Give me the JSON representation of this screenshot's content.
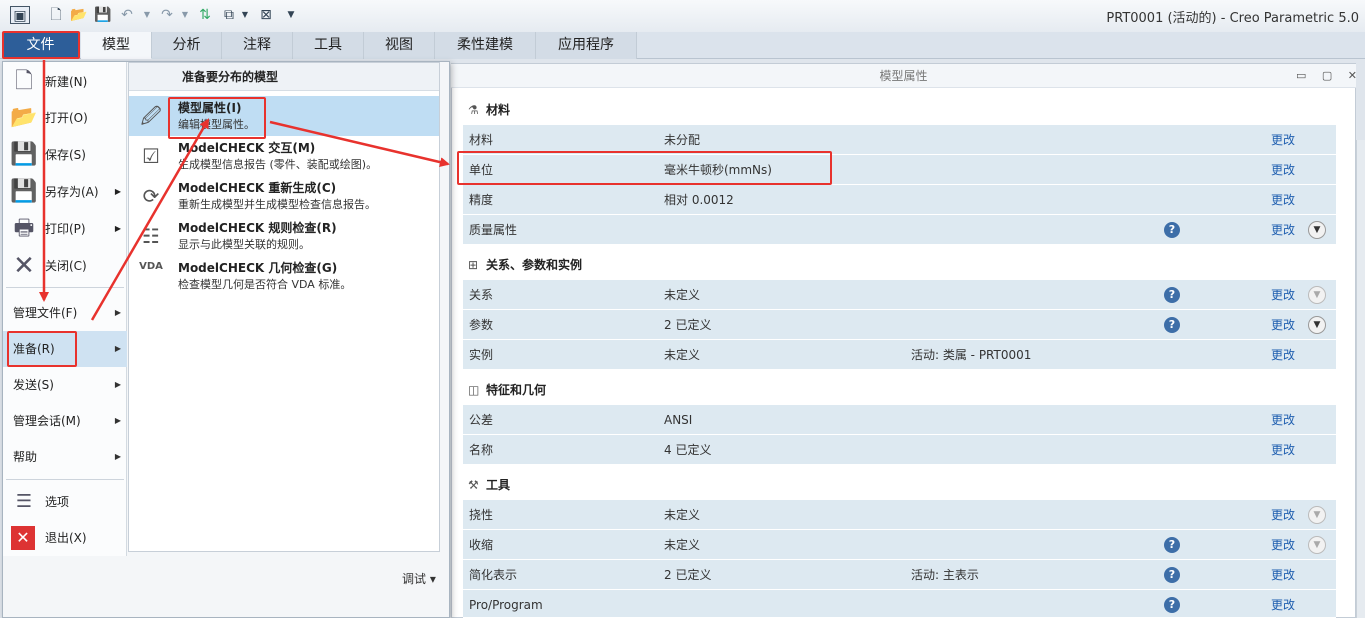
{
  "window": {
    "title": "PRT0001 (活动的) - Creo Parametric 5.0"
  },
  "quick_access": {
    "icons": [
      "app-icon",
      "new-icon",
      "open-icon",
      "save-icon",
      "undo-icon",
      "redo-icon",
      "regenerate-icon",
      "windows-icon",
      "close-window-icon",
      "customize-icon"
    ]
  },
  "ribbon": {
    "file_tab": "文件",
    "tabs": [
      "模型",
      "分析",
      "注释",
      "工具",
      "视图",
      "柔性建模",
      "应用程序"
    ]
  },
  "file_menu": {
    "items_top": [
      {
        "label": "新建(N)",
        "icon": "new-doc-icon"
      },
      {
        "label": "打开(O)",
        "icon": "folder-open-icon"
      },
      {
        "label": "保存(S)",
        "icon": "save-icon"
      },
      {
        "label": "另存为(A)",
        "icon": "save-as-icon",
        "arrow": "▶"
      },
      {
        "label": "打印(P)",
        "icon": "printer-icon",
        "arrow": "▶"
      },
      {
        "label": "关闭(C)",
        "icon": "close-x-icon"
      }
    ],
    "items_mid": [
      {
        "label": "管理文件(F)",
        "arrow": "▶"
      },
      {
        "label": "准备(R)",
        "arrow": "▶"
      },
      {
        "label": "发送(S)",
        "arrow": "▶"
      },
      {
        "label": "管理会话(M)",
        "arrow": "▶"
      },
      {
        "label": "帮助",
        "arrow": "▶"
      }
    ],
    "items_bottom": [
      {
        "label": "选项",
        "icon": "options-icon"
      },
      {
        "label": "退出(X)",
        "icon": "exit-icon"
      }
    ],
    "submenu": {
      "header": "准备要分布的模型",
      "items": [
        {
          "title": "模型属性(I)",
          "desc": "编辑模型属性。",
          "icon": "model-props-icon"
        },
        {
          "title": "ModelCHECK 交互(M)",
          "desc": "生成模型信息报告 (零件、装配或绘图)。",
          "icon": "modelcheck-interactive-icon"
        },
        {
          "title": "ModelCHECK 重新生成(C)",
          "desc": "重新生成模型并生成模型检查信息报告。",
          "icon": "modelcheck-regenerate-icon"
        },
        {
          "title": "ModelCHECK 规则检查(R)",
          "desc": "显示与此模型关联的规则。",
          "icon": "modelcheck-rules-icon"
        },
        {
          "title": "ModelCHECK 几何检查(G)",
          "desc": "检查模型几何是否符合 VDA 标准。",
          "icon": "vda-check-icon",
          "badge": "VDA"
        }
      ],
      "debug": "调试 ▾"
    }
  },
  "properties": {
    "title": "模型属性",
    "controls": "▭ ▢ ✕",
    "change_label": "更改",
    "help_glyph": "?",
    "expand_glyph": "▼",
    "sections": [
      {
        "title": "材料",
        "icon": "material-icon",
        "rows": [
          {
            "name": "材料",
            "value": "未分配",
            "extra": ""
          },
          {
            "name": "单位",
            "value": "毫米牛顿秒(mmNs)",
            "extra": ""
          },
          {
            "name": "精度",
            "value": "相对 0.0012",
            "extra": ""
          },
          {
            "name": "质量属性",
            "value": "",
            "extra": ""
          }
        ]
      },
      {
        "title": "关系、参数和实例",
        "icon": "relations-icon",
        "rows": [
          {
            "name": "关系",
            "value": "未定义",
            "extra": ""
          },
          {
            "name": "参数",
            "value": "2 已定义",
            "extra": ""
          },
          {
            "name": "实例",
            "value": "未定义",
            "extra": "活动: 类属 - PRT0001"
          }
        ]
      },
      {
        "title": "特征和几何",
        "icon": "features-icon",
        "rows": [
          {
            "name": "公差",
            "value": "ANSI",
            "extra": ""
          },
          {
            "name": "名称",
            "value": "4 已定义",
            "extra": ""
          }
        ]
      },
      {
        "title": "工具",
        "icon": "tools-icon",
        "rows": [
          {
            "name": "挠性",
            "value": "未定义",
            "extra": ""
          },
          {
            "name": "收缩",
            "value": "未定义",
            "extra": ""
          },
          {
            "name": "简化表示",
            "value": "2 已定义",
            "extra": "活动: 主表示"
          },
          {
            "name": "Pro/Program",
            "value": "",
            "extra": ""
          }
        ]
      }
    ]
  },
  "annotation_color": "#e8322d"
}
